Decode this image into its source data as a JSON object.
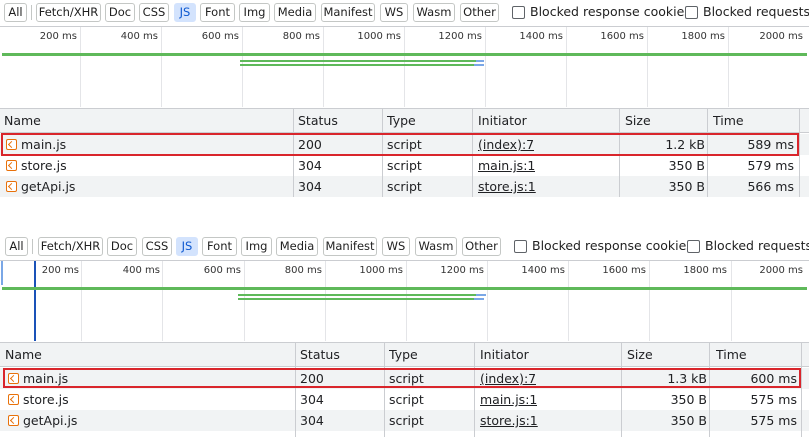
{
  "filters": [
    "All",
    "Fetch/XHR",
    "Doc",
    "CSS",
    "JS",
    "Font",
    "Img",
    "Media",
    "Manifest",
    "WS",
    "Wasm",
    "Other"
  ],
  "active_filter": "JS",
  "checkbox_labels": {
    "blocked_cookies": "Blocked response cookies",
    "blocked_requests": "Blocked requests"
  },
  "timeline_ticks": [
    "200 ms",
    "400 ms",
    "600 ms",
    "800 ms",
    "1000 ms",
    "1200 ms",
    "1400 ms",
    "1600 ms",
    "1800 ms",
    "2000 ms"
  ],
  "columns": {
    "name": "Name",
    "status": "Status",
    "type": "Type",
    "initiator": "Initiator",
    "size": "Size",
    "time": "Time"
  },
  "panels": [
    {
      "rows": [
        {
          "name": "main.js",
          "status": "200",
          "type": "script",
          "initiator": "(index):7",
          "size": "1.2 kB",
          "time": "589 ms"
        },
        {
          "name": "store.js",
          "status": "304",
          "type": "script",
          "initiator": "main.js:1",
          "size": "350 B",
          "time": "579 ms"
        },
        {
          "name": "getApi.js",
          "status": "304",
          "type": "script",
          "initiator": "store.js:1",
          "size": "350 B",
          "time": "566 ms"
        }
      ]
    },
    {
      "rows": [
        {
          "name": "main.js",
          "status": "200",
          "type": "script",
          "initiator": "(index):7",
          "size": "1.3 kB",
          "time": "600 ms"
        },
        {
          "name": "store.js",
          "status": "304",
          "type": "script",
          "initiator": "main.js:1",
          "size": "350 B",
          "time": "575 ms"
        },
        {
          "name": "getApi.js",
          "status": "304",
          "type": "script",
          "initiator": "store.js:1",
          "size": "350 B",
          "time": "575 ms"
        }
      ]
    }
  ]
}
